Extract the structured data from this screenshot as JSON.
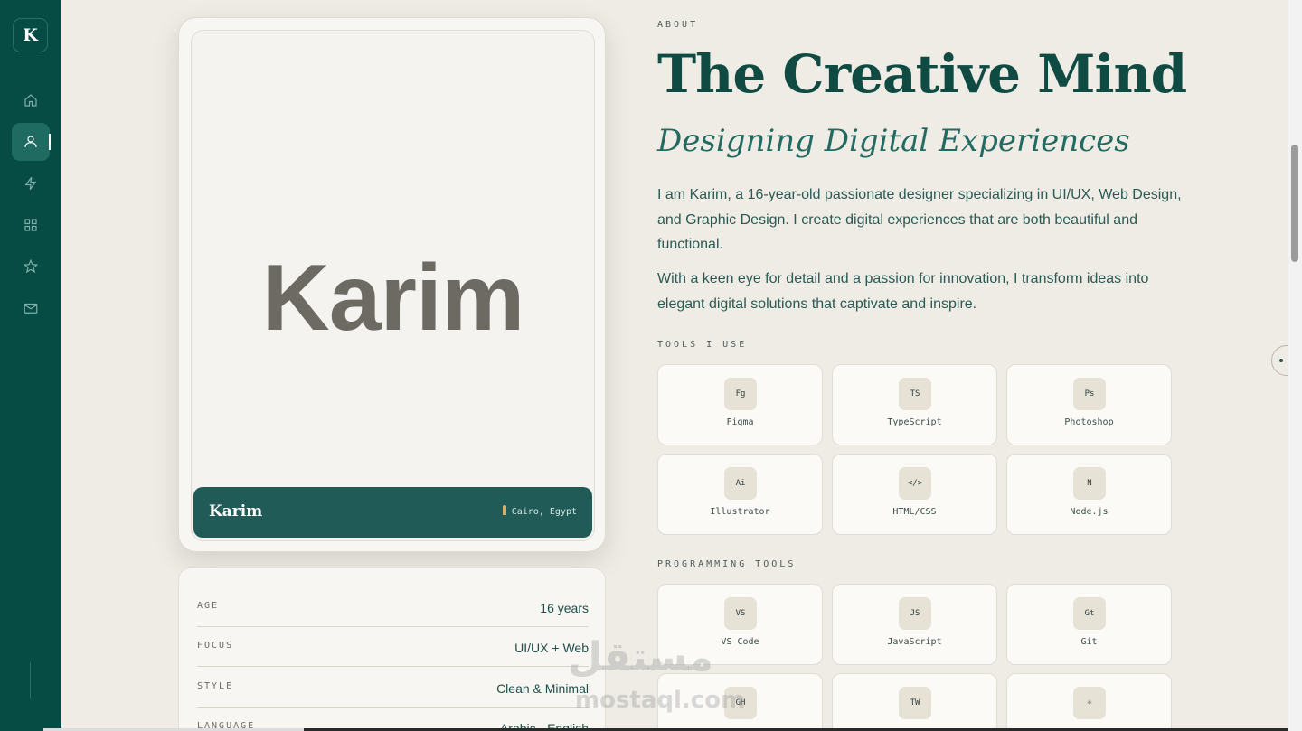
{
  "sidebar": {
    "logo": "K",
    "items": [
      {
        "name": "home",
        "icon": "home-icon"
      },
      {
        "name": "about",
        "icon": "user-icon",
        "active": true
      },
      {
        "name": "skills",
        "icon": "bolt-icon"
      },
      {
        "name": "projects",
        "icon": "grid-icon"
      },
      {
        "name": "favorites",
        "icon": "star-icon"
      },
      {
        "name": "contact",
        "icon": "mail-icon"
      }
    ]
  },
  "profile": {
    "photo_name": "Karim",
    "name": "Karim",
    "location": "Cairo, Egypt"
  },
  "info": [
    {
      "key": "AGE",
      "value": "16 years"
    },
    {
      "key": "FOCUS",
      "value": "UI/UX + Web"
    },
    {
      "key": "STYLE",
      "value": "Clean & Minimal"
    },
    {
      "key": "LANGUAGE",
      "value": "Arabic · English"
    }
  ],
  "about": {
    "label": "ABOUT",
    "title": "The Creative Mind",
    "subtitle": "Designing Digital Experiences",
    "para1": "I am Karim, a 16-year-old passionate designer specializing in UI/UX, Web Design, and Graphic Design. I create digital experiences that are both beautiful and functional.",
    "para2": "With a keen eye for detail and a passion for innovation, I transform ideas into elegant digital solutions that captivate and inspire."
  },
  "tools": {
    "label": "TOOLS I USE",
    "items": [
      {
        "icon": "Fg",
        "name": "Figma"
      },
      {
        "icon": "TS",
        "name": "TypeScript"
      },
      {
        "icon": "Ps",
        "name": "Photoshop"
      },
      {
        "icon": "Ai",
        "name": "Illustrator"
      },
      {
        "icon": "</>",
        "name": "HTML/CSS"
      },
      {
        "icon": "N",
        "name": "Node.js"
      }
    ]
  },
  "programming": {
    "label": "PROGRAMMING TOOLS",
    "items": [
      {
        "icon": "VS",
        "name": "VS Code"
      },
      {
        "icon": "JS",
        "name": "JavaScript"
      },
      {
        "icon": "Gt",
        "name": "Git"
      },
      {
        "icon": "GH",
        "name": ""
      },
      {
        "icon": "TW",
        "name": ""
      },
      {
        "icon": "⚛",
        "name": ""
      }
    ]
  },
  "watermark": {
    "arabic": "مستقل",
    "latin": "mostaql.com"
  }
}
